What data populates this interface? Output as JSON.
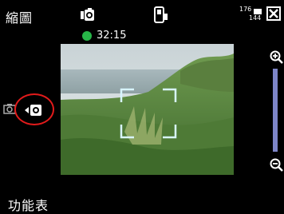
{
  "window": {
    "title": "縮圖"
  },
  "status": {
    "recording_time": "32:15"
  },
  "resolution": {
    "value": "176",
    "sub": "144"
  },
  "softkey": {
    "left_label": "功能表"
  },
  "icons": {
    "video_mode": "video-camera-icon",
    "storage": "phone-storage-icon",
    "resolution": "resolution-icon",
    "close": "close-icon",
    "zoom_in": "zoom-in-icon",
    "zoom_out": "zoom-out-icon",
    "focus": "focus-frame-icon",
    "mode_toggle": "camera-video-toggle-icon"
  },
  "colors": {
    "record_dot": "#27b548",
    "zoom_track": "#7e86c8",
    "highlight_circle": "#e21b1b",
    "focus_frame": "#d8f4ff"
  }
}
